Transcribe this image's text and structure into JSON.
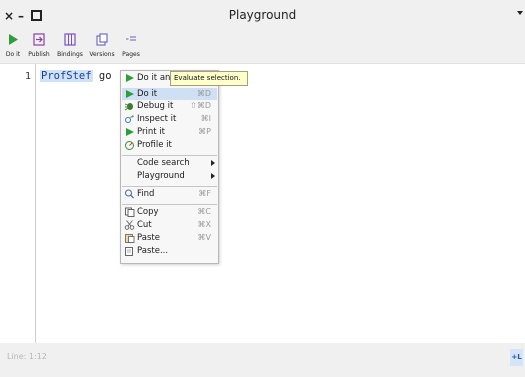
{
  "window": {
    "title": "Playground",
    "close": "×",
    "minimize": "–"
  },
  "toolbar": {
    "items": [
      {
        "label": "Do it",
        "icon": "play-icon"
      },
      {
        "label": "Publish",
        "icon": "publish-icon"
      },
      {
        "label": "Bindings",
        "icon": "bindings-icon"
      },
      {
        "label": "Versions",
        "icon": "versions-icon"
      },
      {
        "label": "Pages",
        "icon": "pages-icon"
      }
    ]
  },
  "editor": {
    "line_number": "1",
    "selected_text": "ProfStef",
    "rest_text": " go"
  },
  "context_menu": {
    "items": [
      {
        "label": "Do it and go",
        "shortcut": "",
        "icon": "play-icon"
      },
      {
        "label": "Do it",
        "shortcut": "⌘D",
        "icon": "play-icon"
      },
      {
        "label": "Debug it",
        "shortcut": "⇧⌘D",
        "icon": "bug-icon"
      },
      {
        "label": "Inspect it",
        "shortcut": "⌘I",
        "icon": "inspect-icon"
      },
      {
        "label": "Print it",
        "shortcut": "⌘P",
        "icon": "play-icon"
      },
      {
        "label": "Profile it",
        "shortcut": "",
        "icon": "profile-icon"
      },
      {
        "label": "Code search",
        "shortcut": "",
        "icon": ""
      },
      {
        "label": "Playground",
        "shortcut": "",
        "icon": ""
      },
      {
        "label": "Find",
        "shortcut": "⌘F",
        "icon": "search-icon"
      },
      {
        "label": "Copy",
        "shortcut": "⌘C",
        "icon": "copy-icon"
      },
      {
        "label": "Cut",
        "shortcut": "⌘X",
        "icon": "cut-icon"
      },
      {
        "label": "Paste",
        "shortcut": "⌘V",
        "icon": "paste-icon"
      },
      {
        "label": "Paste...",
        "shortcut": "",
        "icon": "paste-icon"
      }
    ]
  },
  "tooltip": {
    "text": "Evaluate selection."
  },
  "status": {
    "position": "Line: 1:12",
    "button": "+L"
  },
  "colors": {
    "accent_green": "#2e9e3a",
    "selection": "#cfe2f6",
    "menu_highlight": "#cfe0f5",
    "tooltip_bg": "#ffffcc"
  }
}
